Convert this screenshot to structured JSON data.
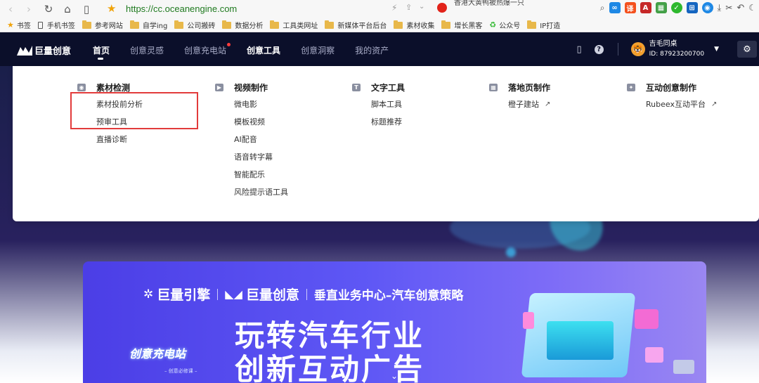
{
  "browser": {
    "url": "https://cc.oceanengine.com",
    "tab_peek": "香港大黄鸭被热爆一只",
    "bookmarks": [
      "书签",
      "手机书签",
      "参考网站",
      "自学ing",
      "公司搬砖",
      "数据分析",
      "工具类网址",
      "新媒体平台后台",
      "素材收集",
      "增长黑客",
      "公众号",
      "IP打造"
    ]
  },
  "header": {
    "logo_text": "巨量创意",
    "nav": [
      "首页",
      "创意灵感",
      "创意充电站",
      "创意工具",
      "创意洞察",
      "我的资产"
    ],
    "active_nav": "首页",
    "highlighted_nav": "创意工具",
    "user_name": "吉毛同桌",
    "user_id": "ID: 87923200700"
  },
  "dropdown": {
    "columns": [
      {
        "title": "素材检测",
        "items": [
          "素材投前分析",
          "预审工具",
          "直播诊断"
        ]
      },
      {
        "title": "视频制作",
        "items": [
          "微电影",
          "模板视频",
          "AI配音",
          "语音转字幕",
          "智能配乐",
          "风险提示语工具"
        ]
      },
      {
        "title": "文字工具",
        "items": [
          "脚本工具",
          "标题推荐"
        ]
      },
      {
        "title": "落地页制作",
        "items": [
          "橙子建站"
        ]
      },
      {
        "title": "互动创意制作",
        "items": [
          "Rubeex互动平台"
        ]
      }
    ]
  },
  "banner": {
    "brand_left": "巨量引擎",
    "brand_right": "巨量创意",
    "brand_subtitle": "垂直业务中心–汽车创意策略",
    "title_line1": "玩转汽车行业",
    "title_line2": "创新互动广告",
    "badge": "创意充电站",
    "badge_sub": "– 创意必修课 –"
  },
  "colors": {
    "header_bg": "#0b0f2a",
    "url_green": "#1f7a1f",
    "highlight_red": "#e23b3b",
    "banner_blue": "#5e57f5"
  }
}
